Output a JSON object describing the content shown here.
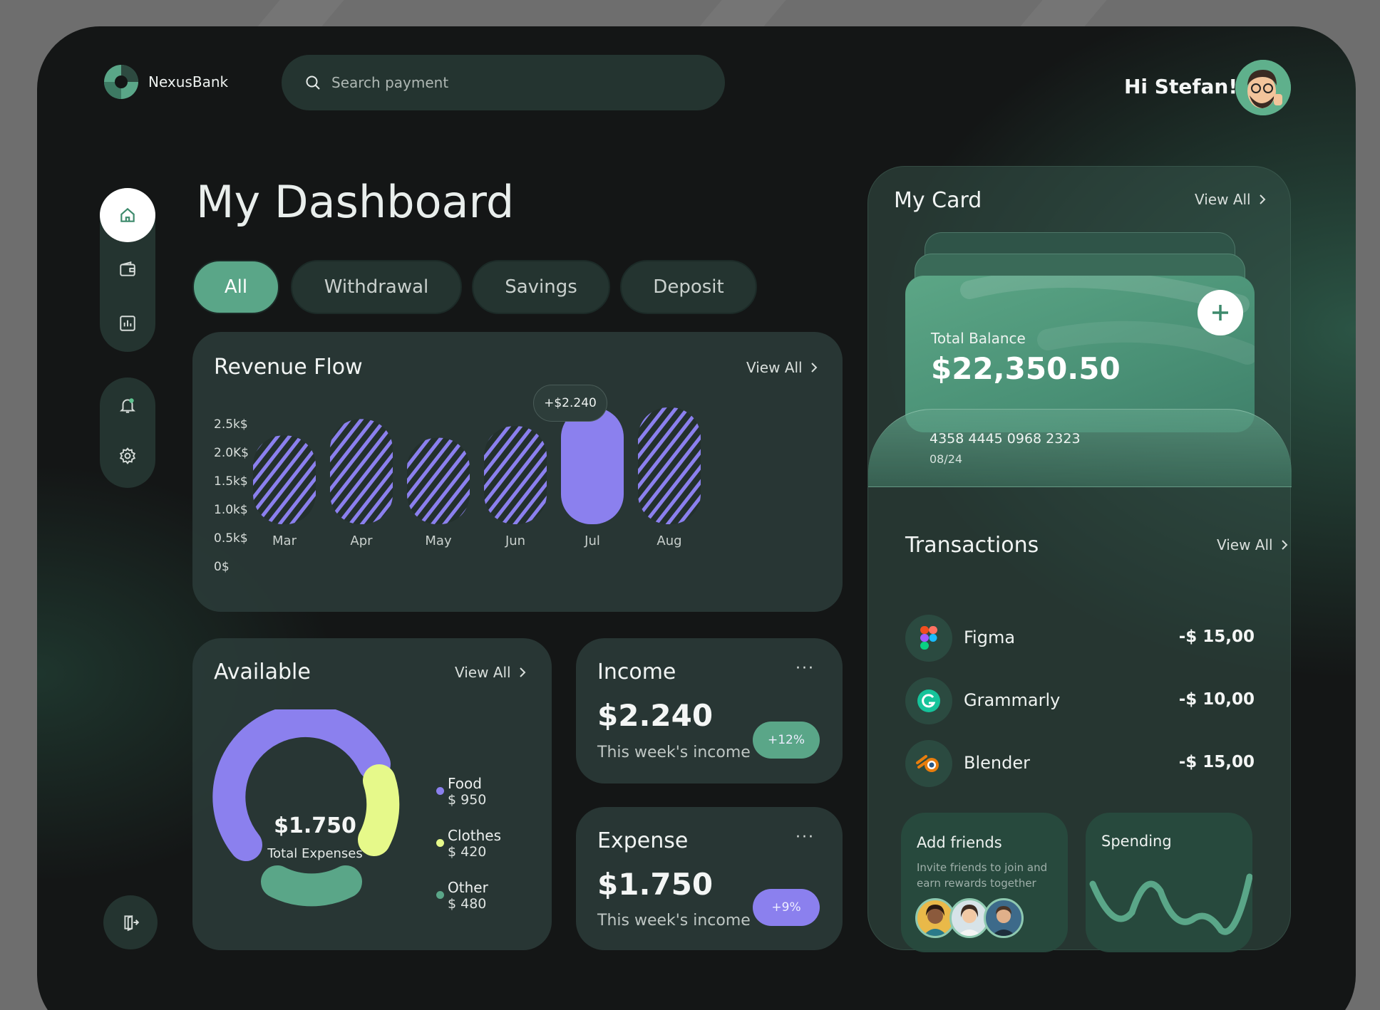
{
  "app": {
    "name": "NexusBank"
  },
  "search": {
    "placeholder": "Search payment"
  },
  "header": {
    "greeting": "Hi Stefan!"
  },
  "page": {
    "title": "My Dashboard"
  },
  "filters": {
    "tabs": [
      "All",
      "Withdrawal",
      "Savings",
      "Deposit"
    ],
    "active": "All"
  },
  "revenue": {
    "title": "Revenue Flow",
    "view_all": "View All",
    "tooltip": "+$2.240",
    "y_ticks": [
      "2.5k$",
      "2.0K$",
      "1.5k$",
      "1.0k$",
      "0.5k$",
      "0$"
    ]
  },
  "chart_data": {
    "type": "bar",
    "categories": [
      "Mar",
      "Apr",
      "May",
      "Jun",
      "Jul",
      "Aug"
    ],
    "values": [
      1900,
      2250,
      1850,
      2100,
      2500,
      2500
    ],
    "highlighted": "Jul",
    "ylim": [
      0,
      2500
    ],
    "xlabel": "",
    "ylabel": "",
    "colors": {
      "bar": "#8b80ee",
      "bar_pattern": "diagonal-stripes"
    }
  },
  "available": {
    "title": "Available",
    "view_all": "View All",
    "center_value": "$1.750",
    "center_label": "Total Expenses",
    "legend": [
      {
        "name": "Food",
        "value": "$ 950",
        "color": "#8b80ee"
      },
      {
        "name": "Clothes",
        "value": "$ 420",
        "color": "#e6f98a"
      },
      {
        "name": "Other",
        "value": "$ 480",
        "color": "#5aa688"
      }
    ]
  },
  "income": {
    "title": "Income",
    "amount": "$2.240",
    "caption": "This week's income",
    "change": "+12%",
    "color": "#5aa688"
  },
  "expense": {
    "title": "Expense",
    "amount": "$1.750",
    "caption": "This week's income",
    "change": "+9%",
    "color": "#8b80ee"
  },
  "my_card": {
    "title": "My Card",
    "view_all": "View All",
    "balance_label": "Total Balance",
    "balance": "$22,350.50",
    "number": "4358 4445 0968 2323",
    "expiry": "08/24"
  },
  "transactions": {
    "title": "Transactions",
    "view_all": "View All",
    "items": [
      {
        "name": "Figma",
        "amount": "-$ 15,00",
        "icon": "figma-icon"
      },
      {
        "name": "Grammarly",
        "amount": "-$ 10,00",
        "icon": "grammarly-icon"
      },
      {
        "name": "Blender",
        "amount": "-$ 15,00",
        "icon": "blender-icon"
      }
    ]
  },
  "add_friends": {
    "title": "Add friends",
    "text": "Invite friends to join and earn rewards together"
  },
  "spending": {
    "title": "Spending"
  },
  "colors": {
    "accent": "#5aa688",
    "purple": "#8b80ee",
    "lime": "#e6f98a",
    "bg": "#141616"
  }
}
